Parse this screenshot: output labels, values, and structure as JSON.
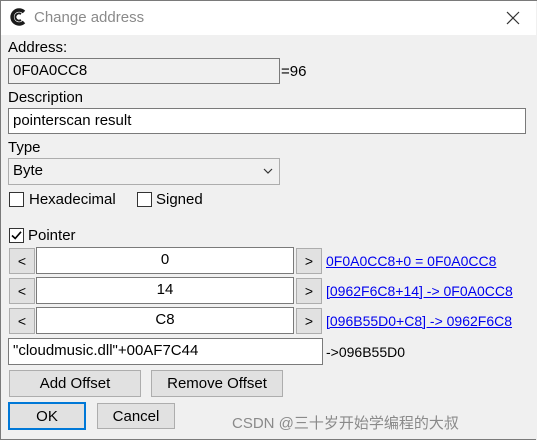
{
  "window": {
    "title": "Change address"
  },
  "address": {
    "label": "Address:",
    "value": "0F0A0CC8",
    "result": "=96"
  },
  "description": {
    "label": "Description",
    "value": "pointerscan result"
  },
  "type": {
    "label": "Type",
    "selected": "Byte"
  },
  "options": {
    "hexadecimal_label": "Hexadecimal",
    "hexadecimal_checked": false,
    "signed_label": "Signed",
    "signed_checked": false
  },
  "pointer": {
    "label": "Pointer",
    "checked": true,
    "offsets": [
      {
        "dec_label": "<",
        "value": "0",
        "inc_label": ">",
        "result": "0F0A0CC8+0 = 0F0A0CC8"
      },
      {
        "dec_label": "<",
        "value": "14",
        "inc_label": ">",
        "result": "[0962F6C8+14] -> 0F0A0CC8"
      },
      {
        "dec_label": "<",
        "value": "C8",
        "inc_label": ">",
        "result": "[096B55D0+C8] -> 0962F6C8"
      }
    ],
    "base_address": "\"cloudmusic.dll\"+00AF7C44",
    "base_result": "->096B55D0"
  },
  "buttons": {
    "add_offset": "Add Offset",
    "remove_offset": "Remove Offset",
    "ok": "OK",
    "cancel": "Cancel"
  },
  "watermark": "CSDN @三十岁开始学编程的大叔"
}
